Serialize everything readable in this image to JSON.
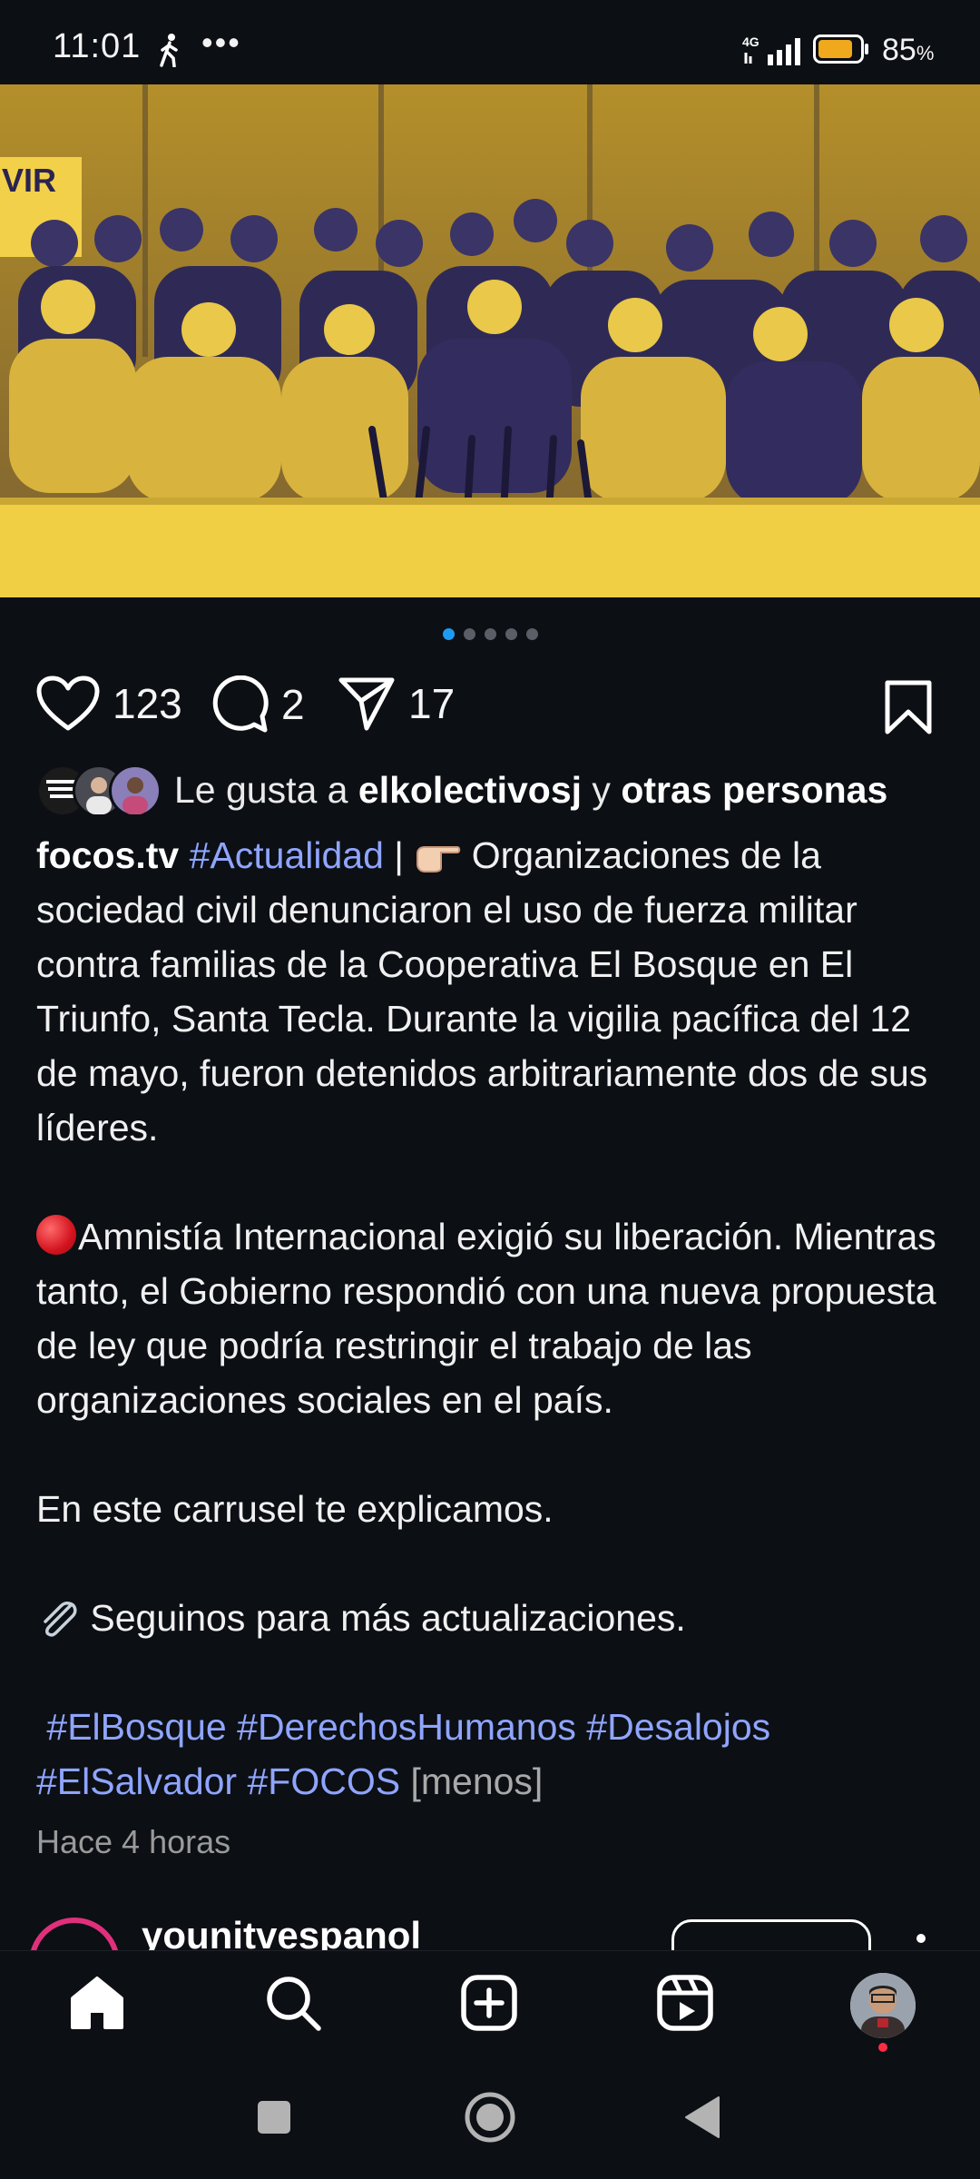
{
  "status_bar": {
    "time": "11:01",
    "dots": "•••",
    "network": "4G",
    "battery_percent": "85",
    "battery_unit": "%",
    "battery_level": 0.85,
    "battery_color": "#f0a81c"
  },
  "post": {
    "carousel": {
      "pages": 5,
      "active_index": 0
    },
    "actions": {
      "like_count": "123",
      "comment_count": "2",
      "share_count": "17"
    },
    "likes": {
      "prefix": "Le gusta a ",
      "user": "elkolectivosj",
      "joiner": " y ",
      "others": "otras personas"
    },
    "caption": {
      "username": "focos.tv",
      "tag_actualidad": "#Actualidad",
      "separator": " | ",
      "para1": " Organizaciones de la sociedad civil denunciaron el uso de fuerza militar contra familias de la Cooperativa El Bosque en El Triunfo, Santa Tecla. Durante la vigilia pacífica del 12 de mayo, fueron detenidos arbitrariamente dos de sus líderes.",
      "para2": "Amnistía Internacional exigió su liberación. Mientras tanto, el Gobierno respondió con una nueva propuesta de ley que podría restringir el trabajo de las organizaciones sociales en el país.",
      "para3": "En este carrusel te explicamos.",
      "para4": " Seguinos para más actualizaciones.",
      "hashtags": [
        "#ElBosque",
        "#DerechosHumanos",
        "#Desalojos",
        "#ElSalvador",
        "#FOCOS"
      ],
      "less_label": "[menos]"
    },
    "time_ago": "Hace 4 horas"
  },
  "next_post": {
    "username": "younitvespanol"
  },
  "colors": {
    "background": "#0c0f14",
    "hashtag": "#8fa5ff",
    "active_dot": "#1d9bf0",
    "image_tint": "#e2b92e"
  }
}
